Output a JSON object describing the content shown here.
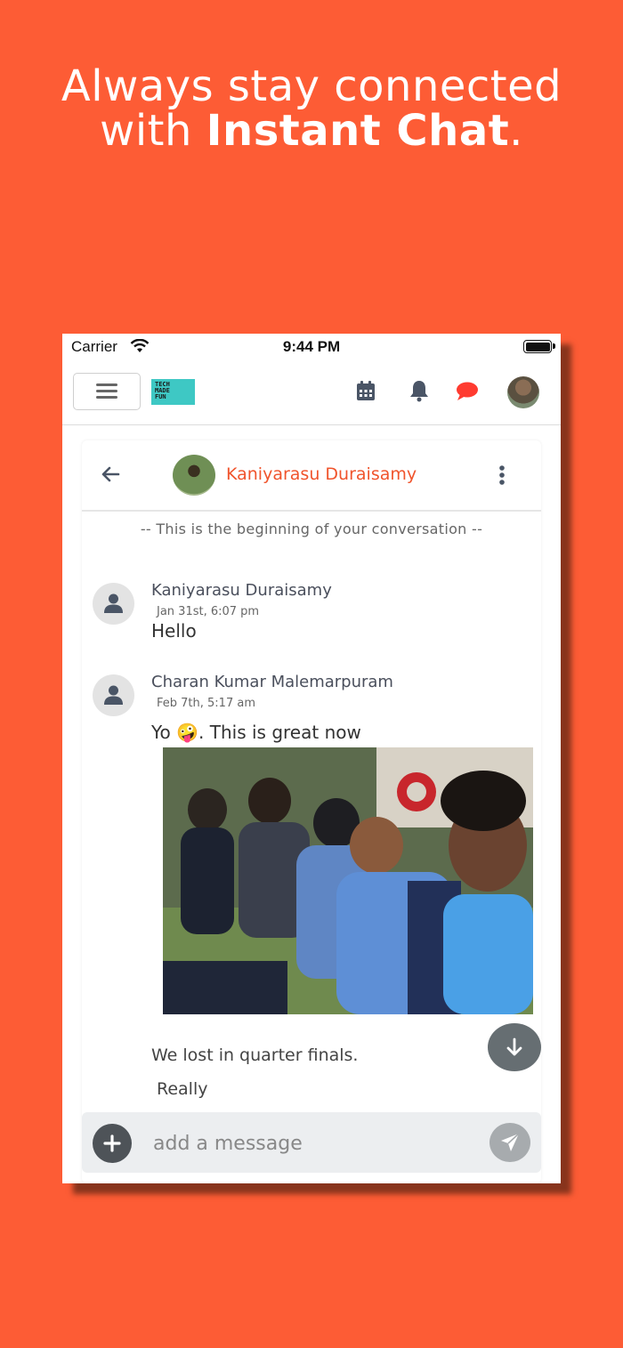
{
  "headline": {
    "line1": "Always stay connected",
    "line2_prefix": "with ",
    "line2_bold": "Instant Chat",
    "line2_suffix": "."
  },
  "status_bar": {
    "carrier": "Carrier",
    "time": "9:44 PM"
  },
  "navbar": {
    "logo_text": "TECH MADE FUN",
    "icons": [
      "menu-icon",
      "calendar-icon",
      "bell-icon",
      "chat-bubble-icon",
      "user-avatar"
    ]
  },
  "chat": {
    "contact_name": "Kaniyarasu Duraisamy",
    "conversation_start": "-- This is the beginning of your conversation --",
    "messages": [
      {
        "sender": "Kaniyarasu Duraisamy",
        "time": "Jan 31st, 6:07 pm",
        "text": "Hello"
      },
      {
        "sender": "Charan Kumar Malemarpuram",
        "time": "Feb 7th, 5:17 am",
        "text": "Yo 🤪. This is great now",
        "followups": [
          "We lost in quarter finals.",
          "Really"
        ]
      }
    ]
  },
  "composer": {
    "placeholder": "add a message"
  },
  "colors": {
    "background": "#fd5c35",
    "accent": "#f0542c",
    "chat_icon": "#ff3b30"
  }
}
